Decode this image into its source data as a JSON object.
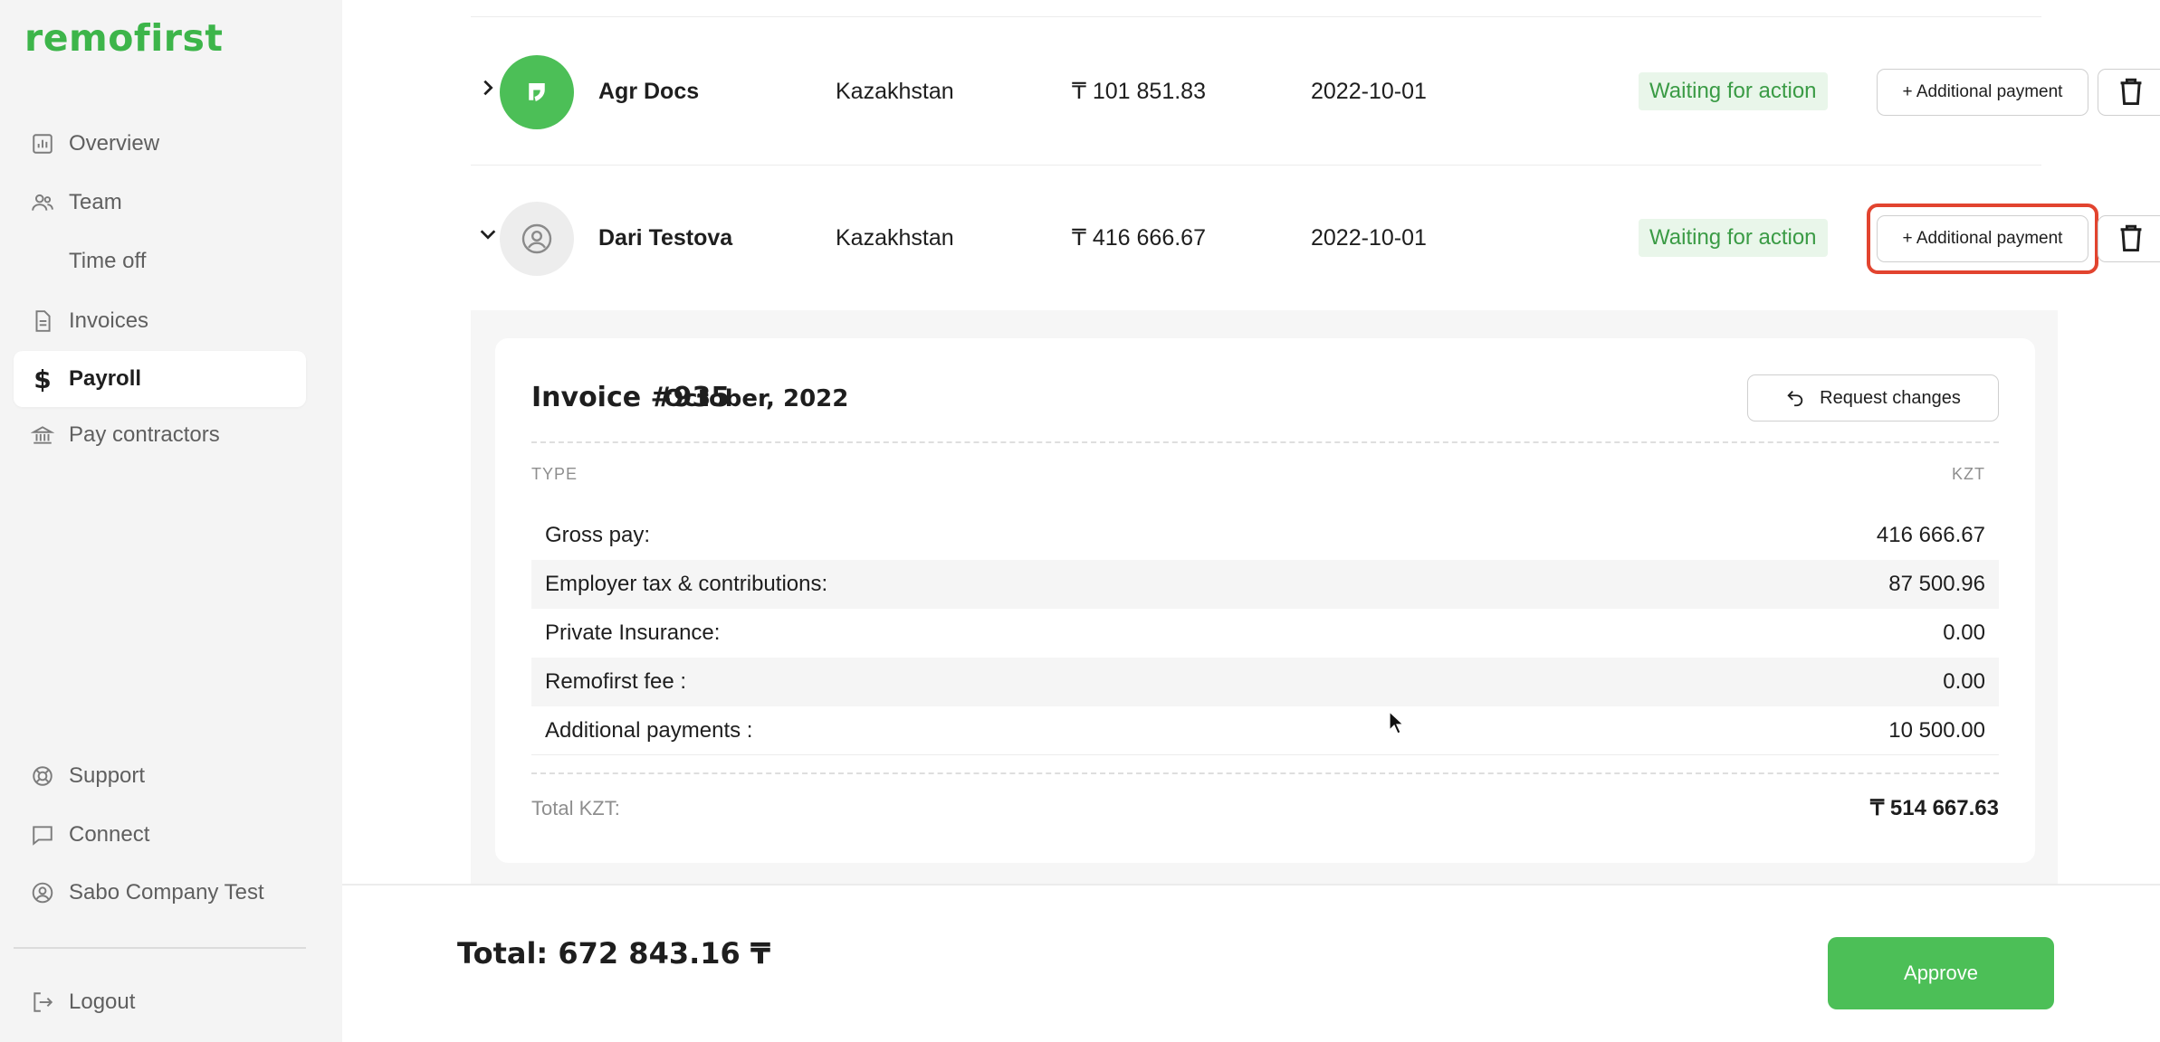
{
  "brand": {
    "logo_text": "remofirst",
    "accent": "#3db54a"
  },
  "sidebar": {
    "items": [
      {
        "label": "Overview",
        "icon": "chart-icon"
      },
      {
        "label": "Team",
        "icon": "users-icon"
      },
      {
        "label": "Time off",
        "icon": ""
      },
      {
        "label": "Invoices",
        "icon": "document-icon"
      },
      {
        "label": "Payroll",
        "icon": "dollar-icon",
        "active": true
      },
      {
        "label": "Pay contractors",
        "icon": "bank-icon"
      }
    ],
    "bottom_items": [
      {
        "label": "Support",
        "icon": "lifebuoy-icon"
      },
      {
        "label": "Connect",
        "icon": "chat-icon"
      },
      {
        "label": "Sabo Company Test",
        "icon": "user-circle-icon"
      }
    ],
    "logout_label": "Logout"
  },
  "payroll_rows": [
    {
      "name": "Agr Docs",
      "country": "Kazakhstan",
      "amount": "₸ 101 851.83",
      "date": "2022-10-01",
      "status": "Waiting for action",
      "add_payment_label": "+ Additional payment",
      "expanded": false
    },
    {
      "name": "Dari Testova",
      "country": "Kazakhstan",
      "amount": "₸ 416 666.67",
      "date": "2022-10-01",
      "status": "Waiting for action",
      "add_payment_label": "+ Additional payment",
      "expanded": true
    }
  ],
  "invoice": {
    "title": "Invoice #935",
    "period": "October, 2022",
    "request_changes_label": "Request changes",
    "col_type": "TYPE",
    "col_currency": "KZT",
    "lines": [
      {
        "label": "Gross pay:",
        "value": "416 666.67"
      },
      {
        "label": "Employer tax & contributions:",
        "value": "87 500.96"
      },
      {
        "label": "Private Insurance:",
        "value": "0.00"
      },
      {
        "label": "Remofirst fee :",
        "value": "0.00"
      },
      {
        "label": "Additional payments :",
        "value": "10 500.00"
      }
    ],
    "total_label": "Total KZT:",
    "total_value": "₸ 514 667.63"
  },
  "footer": {
    "total_text": "Total: 672 843.16 ₸",
    "approve_label": "Approve"
  },
  "colors": {
    "status_bg": "#e9f6ea",
    "status_text": "#3a9b45",
    "highlight": "#e2442f",
    "approve": "#4cbf57"
  }
}
